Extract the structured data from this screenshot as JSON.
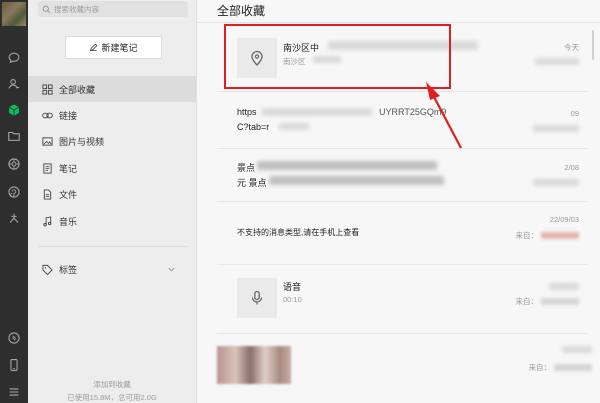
{
  "nav": {
    "search_placeholder": "搜索收藏内容",
    "new_note_label": "新建笔记",
    "items": [
      {
        "label": "全部收藏",
        "icon": "grid-icon",
        "active": true
      },
      {
        "label": "链接",
        "icon": "link-icon"
      },
      {
        "label": "图片与视频",
        "icon": "image-icon"
      },
      {
        "label": "笔记",
        "icon": "note-icon"
      },
      {
        "label": "文件",
        "icon": "file-icon"
      },
      {
        "label": "音乐",
        "icon": "music-icon"
      }
    ],
    "tags_label": "标签",
    "storage_line1": "添加到收藏",
    "storage_line2": "已使用15.8M，总可用2.0G"
  },
  "main": {
    "title": "全部收藏",
    "cards": [
      {
        "type": "location",
        "title": "南沙区中",
        "subtitle": "南沙区",
        "date": "今天"
      },
      {
        "type": "link",
        "line1": "https",
        "line1_tail": "UYRRT25GQm9",
        "line2": "C?tab=r",
        "date": "09"
      },
      {
        "type": "text",
        "line1": "景点",
        "line1_tail": "2/08",
        "line2": "元 景点"
      },
      {
        "type": "text",
        "text": "不支持的消息类型,请在手机上查看",
        "date": "22/09/03",
        "source_prefix": "来自："
      },
      {
        "type": "voice",
        "title": "语音",
        "duration": "00:10",
        "source_prefix": "来自："
      },
      {
        "type": "image",
        "source_prefix": "来自："
      }
    ]
  },
  "colors": {
    "highlight": "#e02020",
    "accent_green": "#07c160"
  }
}
